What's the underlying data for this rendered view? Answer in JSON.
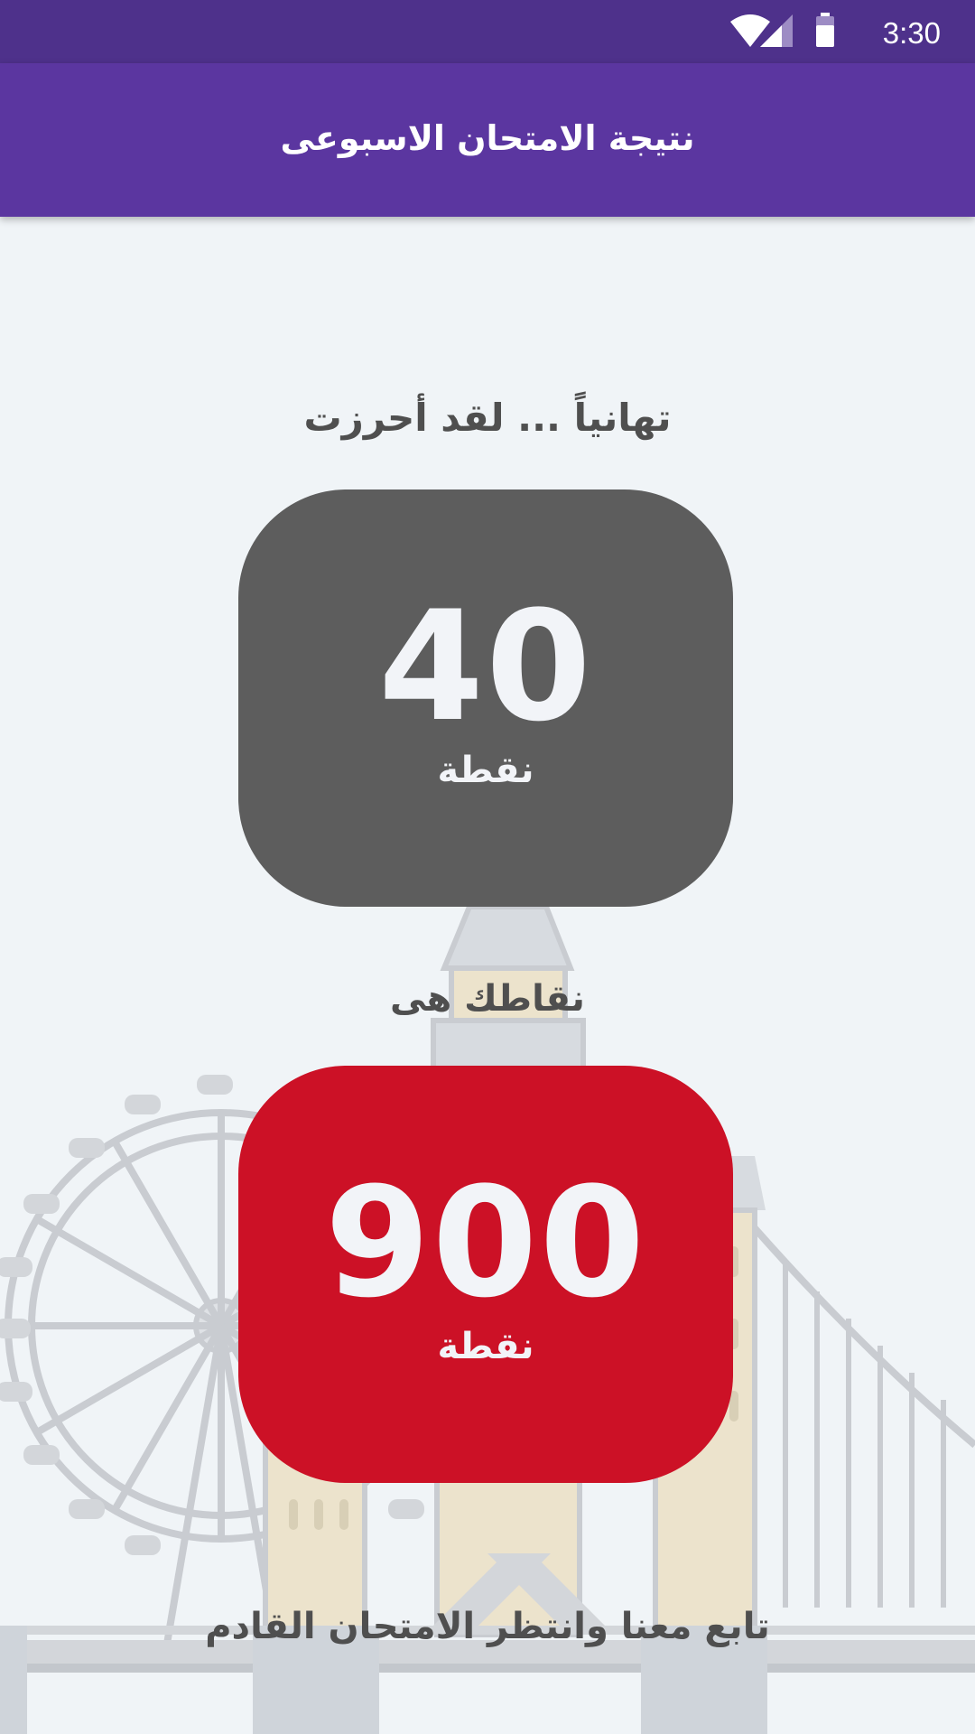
{
  "status_bar": {
    "time": "3:30",
    "icons": [
      "wifi-icon",
      "cell-signal-icon",
      "battery-icon"
    ]
  },
  "app_bar": {
    "title": "نتيجة الامتحان الاسبوعى"
  },
  "result": {
    "congrats_text": "تهانياً ... لقد أحرزت",
    "exam_score": "40",
    "exam_score_unit": "نقطة",
    "total_label": "نقاطك هى",
    "total_points": "900",
    "total_points_unit": "نقطة",
    "footer_text": "تابع معنا وانتظر الامتحان القادم"
  },
  "colors": {
    "status_bar": "#4e318b",
    "app_bar": "#5b36a0",
    "background": "#f0f4f7",
    "exam_card": "#5d5d5d",
    "total_card": "#cc1126",
    "text": "#4f4f4f"
  }
}
